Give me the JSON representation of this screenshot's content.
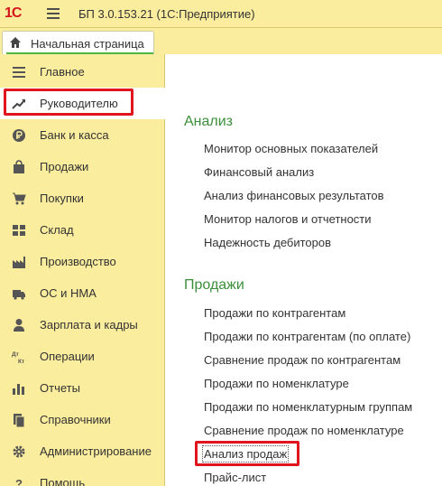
{
  "titlebar": {
    "logo": "1С",
    "title": "БП 3.0.153.21  (1С:Предприятие)"
  },
  "tabs": {
    "home_label": "Начальная страница"
  },
  "sidebar": {
    "items": [
      {
        "label": "Главное",
        "icon": "menu-lines-icon"
      },
      {
        "label": "Руководителю",
        "icon": "trend-up-icon"
      },
      {
        "label": "Банк и касса",
        "icon": "ruble-coin-icon"
      },
      {
        "label": "Продажи",
        "icon": "shopping-bag-icon"
      },
      {
        "label": "Покупки",
        "icon": "cart-icon"
      },
      {
        "label": "Склад",
        "icon": "warehouse-grid-icon"
      },
      {
        "label": "Производство",
        "icon": "factory-icon"
      },
      {
        "label": "ОС и НМА",
        "icon": "truck-icon"
      },
      {
        "label": "Зарплата и кадры",
        "icon": "person-icon"
      },
      {
        "label": "Операции",
        "icon": "dt-kt-icon"
      },
      {
        "label": "Отчеты",
        "icon": "bar-chart-icon"
      },
      {
        "label": "Справочники",
        "icon": "books-icon"
      },
      {
        "label": "Администрирование",
        "icon": "gear-icon"
      },
      {
        "label": "Помощь",
        "icon": "help-icon"
      }
    ],
    "active_index": 1
  },
  "content": {
    "sections": [
      {
        "title": "Анализ",
        "links": [
          "Монитор основных показателей",
          "Финансовый анализ",
          "Анализ финансовых результатов",
          "Монитор налогов и отчетности",
          "Надежность дебиторов"
        ]
      },
      {
        "title": "Продажи",
        "links": [
          "Продажи по контрагентам",
          "Продажи по контрагентам (по оплате)",
          "Сравнение продаж по контрагентам",
          "Продажи по номенклатуре",
          "Продажи по номенклатурным группам",
          "Сравнение продаж по номенклатуре",
          "Анализ продаж",
          "Прайс-лист"
        ]
      }
    ]
  },
  "colors": {
    "panel_yellow": "#fbed9e",
    "section_green": "#3b8f3b",
    "highlight_red": "#e0161f",
    "logo_red": "#d4161d"
  }
}
